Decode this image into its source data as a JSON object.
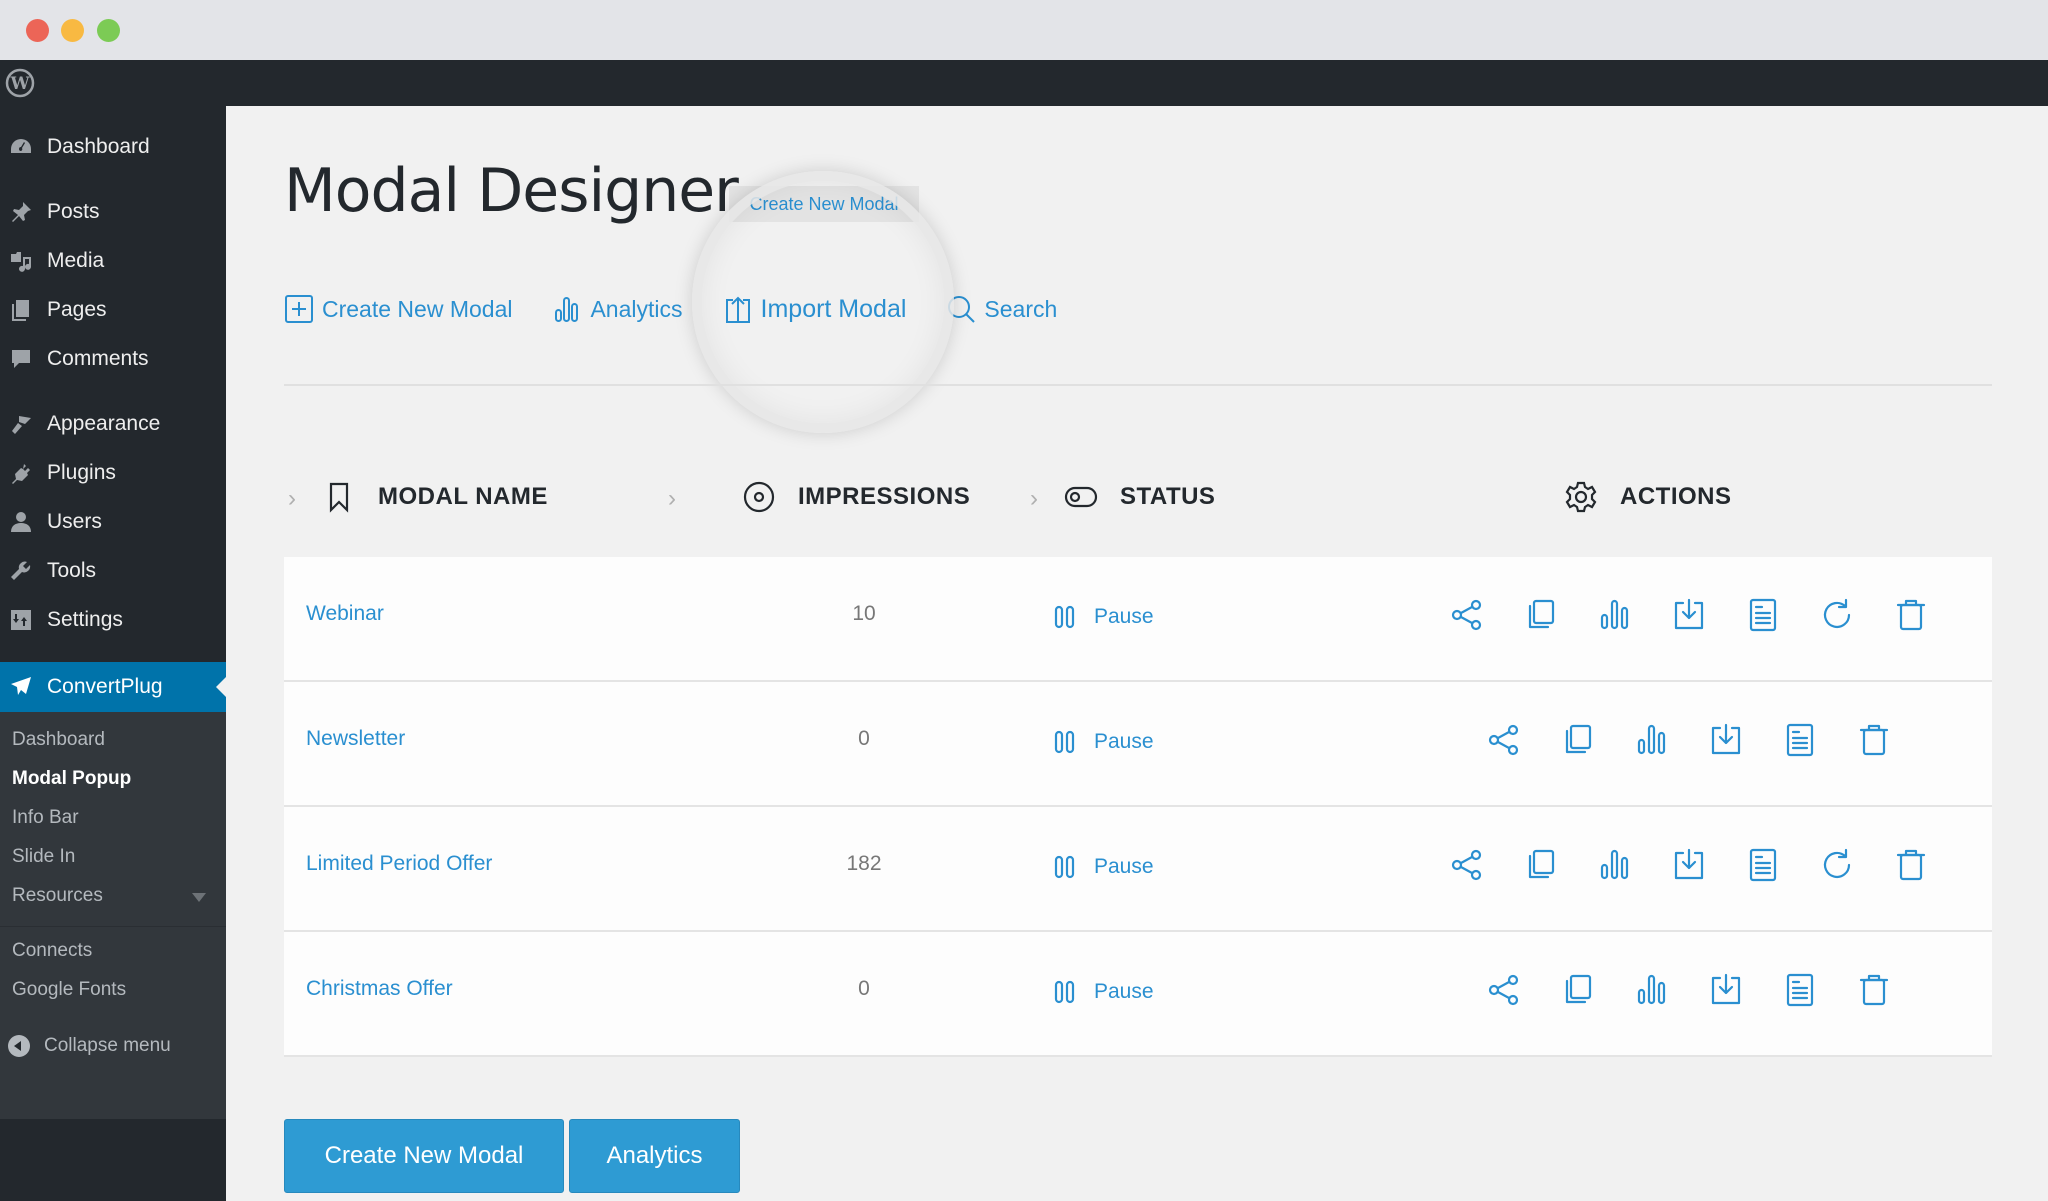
{
  "window": {
    "controls": [
      "close",
      "minimize",
      "maximize"
    ]
  },
  "adminbar": {
    "logo_icon": "wordpress-logo-icon"
  },
  "sidebar": {
    "items": [
      {
        "label": "Dashboard",
        "icon": "dashboard-icon"
      },
      {
        "label": "Posts",
        "icon": "pin-icon"
      },
      {
        "label": "Media",
        "icon": "media-icon"
      },
      {
        "label": "Pages",
        "icon": "pages-icon"
      },
      {
        "label": "Comments",
        "icon": "comment-icon"
      },
      {
        "label": "Appearance",
        "icon": "brush-icon"
      },
      {
        "label": "Plugins",
        "icon": "plug-icon"
      },
      {
        "label": "Users",
        "icon": "user-icon"
      },
      {
        "label": "Tools",
        "icon": "wrench-icon"
      },
      {
        "label": "Settings",
        "icon": "settings-icon"
      },
      {
        "label": "ConvertPlug",
        "icon": "paper-plane-icon",
        "active": true
      }
    ],
    "submenu": [
      {
        "label": "Dashboard"
      },
      {
        "label": "Modal Popup",
        "current": true
      },
      {
        "label": "Info Bar"
      },
      {
        "label": "Slide In"
      },
      {
        "label": "Resources"
      },
      {
        "label": "Connects"
      },
      {
        "label": "Google Fonts"
      }
    ],
    "collapse_label": "Collapse menu"
  },
  "page": {
    "title": "Modal Designer",
    "title_badge": "Create New Modal",
    "toolbar": {
      "create_label": "Create New Modal",
      "analytics_label": "Analytics",
      "import_label": "Import Modal",
      "search_label": "Search"
    }
  },
  "table": {
    "headers": {
      "name": "MODAL NAME",
      "impressions": "IMPRESSIONS",
      "status": "STATUS",
      "actions": "ACTIONS"
    },
    "rows": [
      {
        "name": "Webinar",
        "impressions": "10",
        "status": "Pause",
        "actions": [
          "share",
          "duplicate",
          "analytics",
          "export",
          "details",
          "reset",
          "delete"
        ]
      },
      {
        "name": "Newsletter",
        "impressions": "0",
        "status": "Pause",
        "actions": [
          "share",
          "duplicate",
          "analytics",
          "export",
          "details",
          "delete"
        ]
      },
      {
        "name": "Limited Period Offer",
        "impressions": "182",
        "status": "Pause",
        "actions": [
          "share",
          "duplicate",
          "analytics",
          "export",
          "details",
          "reset",
          "delete"
        ]
      },
      {
        "name": "Christmas Offer",
        "impressions": "0",
        "status": "Pause",
        "actions": [
          "share",
          "duplicate",
          "analytics",
          "export",
          "details",
          "delete"
        ]
      }
    ]
  },
  "footer_buttons": {
    "create_label": "Create New Modal",
    "analytics_label": "Analytics"
  },
  "colors": {
    "accent": "#2a8fd0",
    "button": "#2e9bd3",
    "sidebar_bg": "#23282d",
    "sidebar_active": "#0073aa"
  }
}
